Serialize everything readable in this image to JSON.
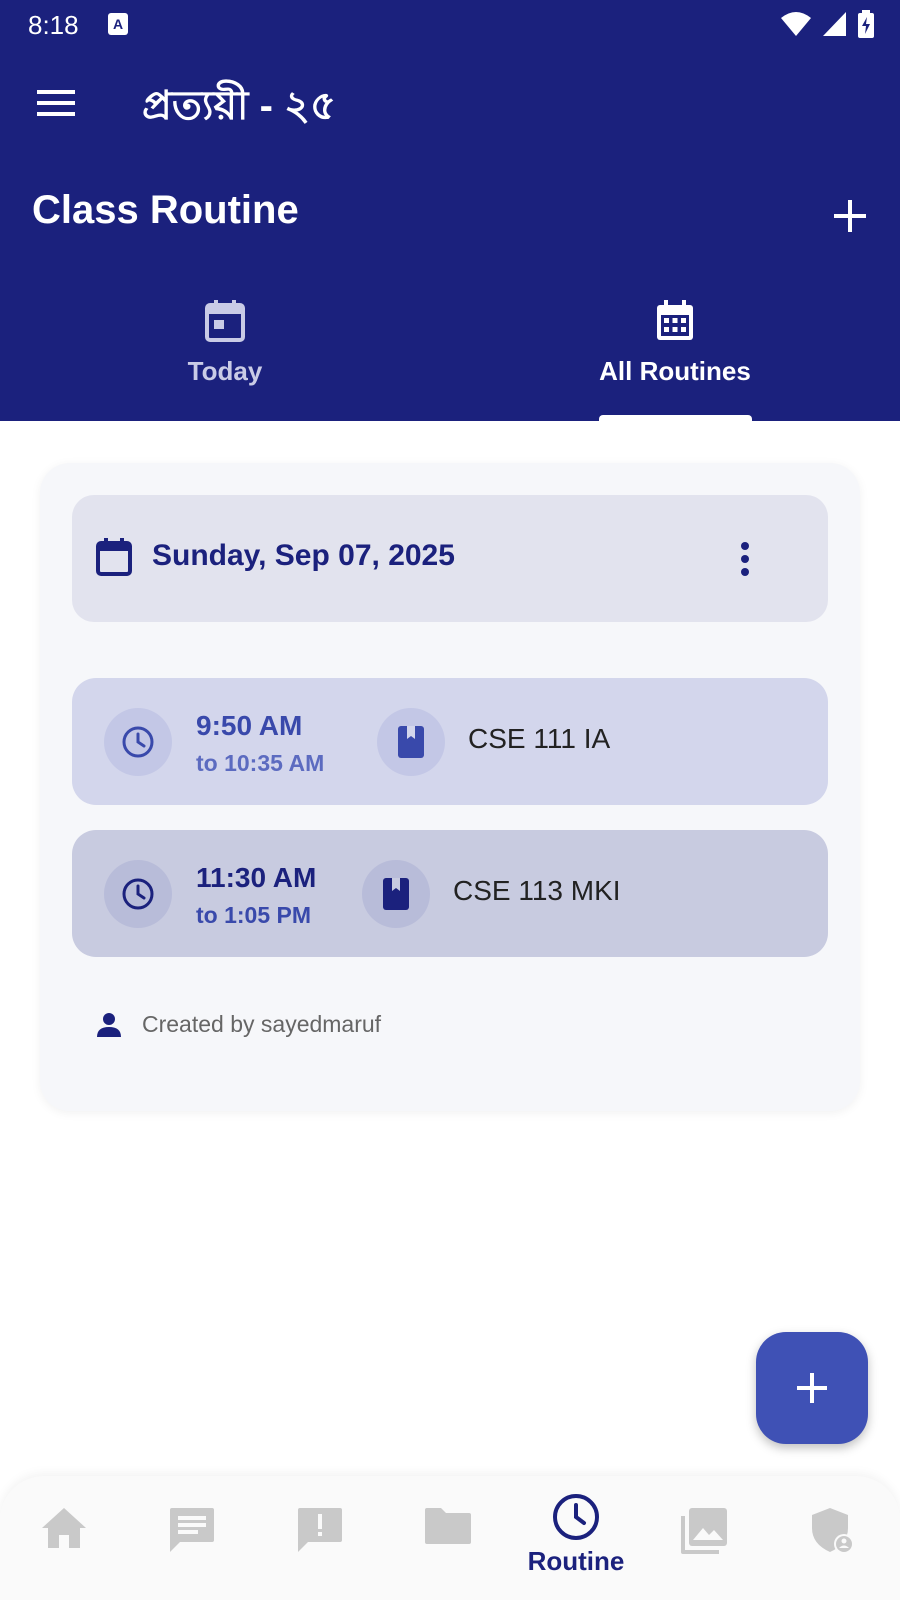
{
  "status_bar": {
    "time": "8:18",
    "notification_badge": "A"
  },
  "app_bar": {
    "title": "প্রত্যয়ী - ২৫"
  },
  "section": {
    "title": "Class Routine"
  },
  "tabs": [
    {
      "label": "Today",
      "icon": "calendar-today-icon",
      "selected": false
    },
    {
      "label": "All Routines",
      "icon": "calendar-grid-icon",
      "selected": true
    }
  ],
  "routine": {
    "date": "Sunday, Sep 07, 2025",
    "slots": [
      {
        "start": "9:50 AM",
        "end": "to 10:35 AM",
        "course": "CSE 111 IA"
      },
      {
        "start": "11:30 AM",
        "end": "to 1:05 PM",
        "course": "CSE 113 MKI"
      }
    ],
    "created_by": "Created by sayedmaruf"
  },
  "bottom_nav": {
    "items": [
      {
        "icon": "home-icon"
      },
      {
        "icon": "chat-icon"
      },
      {
        "icon": "alert-icon"
      },
      {
        "icon": "folder-icon"
      },
      {
        "icon": "clock-icon",
        "label": "Routine",
        "active": true
      },
      {
        "icon": "gallery-icon"
      },
      {
        "icon": "admin-shield-icon"
      }
    ]
  },
  "colors": {
    "primary": "#1b217d",
    "accent": "#3f51b5",
    "inactive": "#c9c9c9"
  }
}
